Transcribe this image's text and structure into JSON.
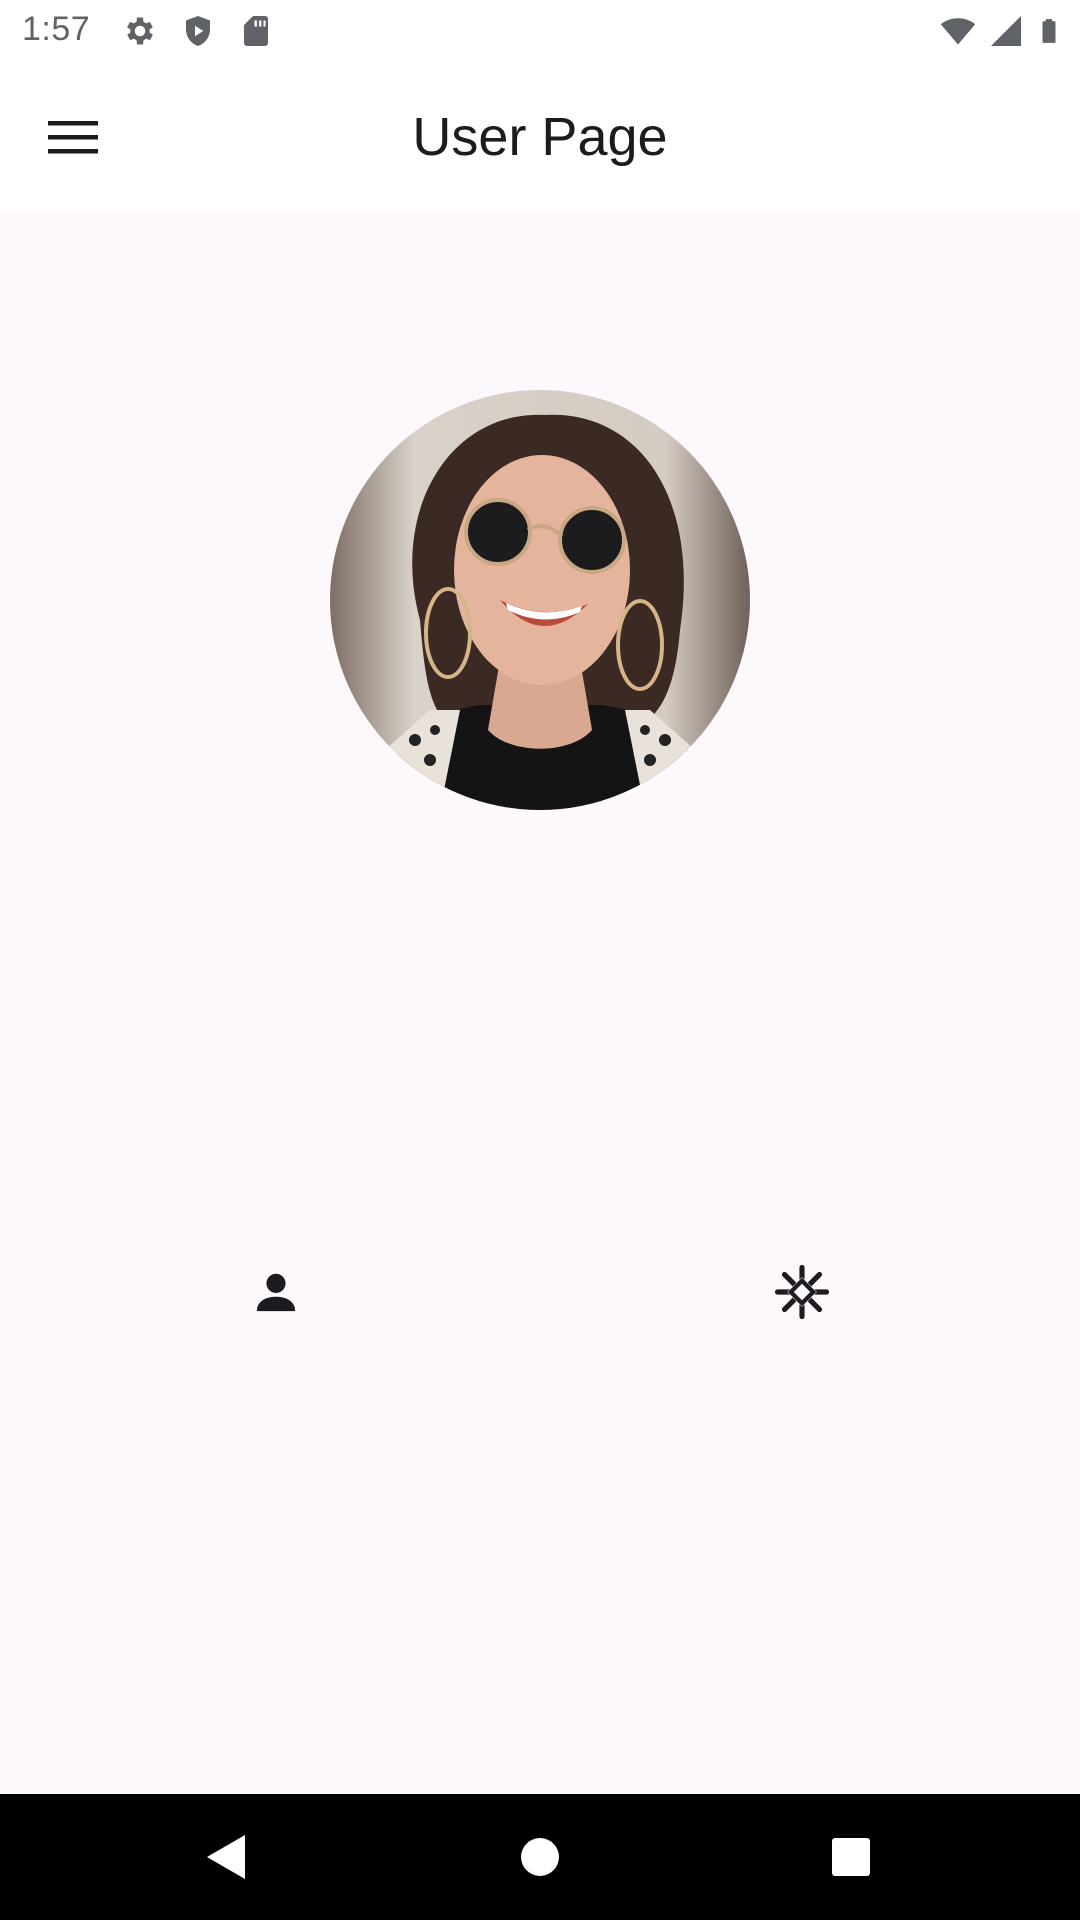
{
  "status_bar": {
    "time": "1:57",
    "left_icons": [
      "gear-icon",
      "shield-icon",
      "sd-card-icon"
    ],
    "right_icons": [
      "wifi-icon",
      "signal-icon",
      "battery-icon"
    ]
  },
  "app_bar": {
    "title": "User Page",
    "menu_icon": "hamburger-menu-icon"
  },
  "profile": {
    "avatar": "profile-photo"
  },
  "actions": {
    "left_icon": "person-icon",
    "right_icon": "asterisk-icon"
  },
  "nav_bar": {
    "icons": [
      "back-icon",
      "home-icon",
      "recents-icon"
    ]
  },
  "colors": {
    "background": "#fdf8fc",
    "app_bar": "#ffffff",
    "text": "#1d1b20",
    "nav_bar": "#000000"
  }
}
